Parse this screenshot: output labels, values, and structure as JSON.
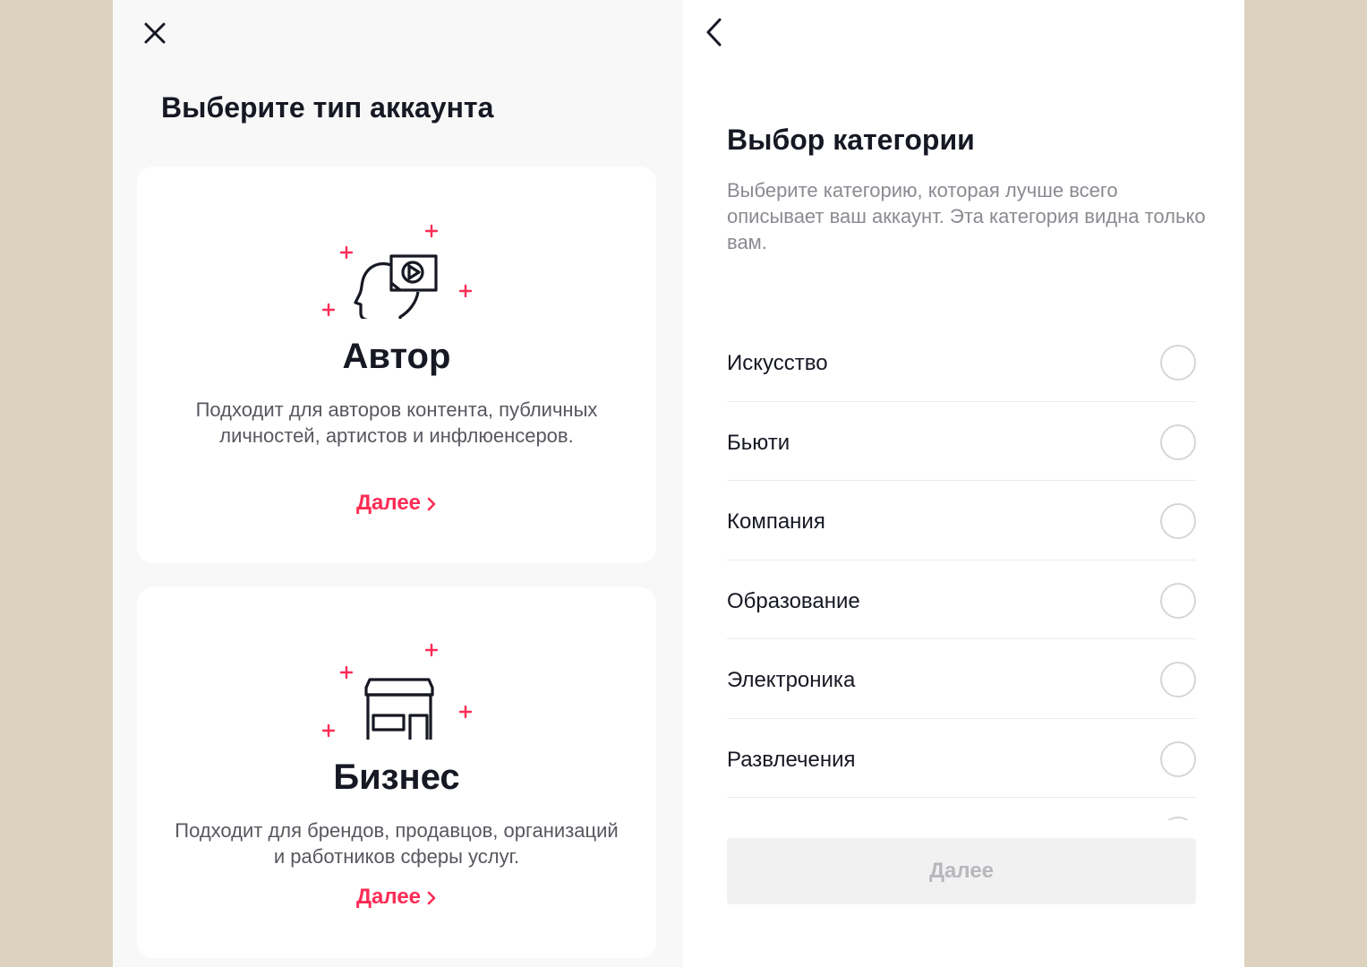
{
  "colors": {
    "background": "#dcd2bd",
    "accent": "#fe2c55",
    "text": "#161823",
    "muted": "#8a8b91",
    "disabled_button": "#f1f1f2"
  },
  "account_type": {
    "title": "Выберите тип аккаунта",
    "close_icon": "close-icon",
    "cards": [
      {
        "icon": "creator-head-play-icon",
        "title": "Автор",
        "description": "Подходит для авторов контента, публичных личностей, артистов и инфлюенсеров.",
        "link": "Далее"
      },
      {
        "icon": "storefront-icon",
        "title": "Бизнес",
        "description": "Подходит для брендов, продавцов, организаций и работников сферы услуг.",
        "link": "Далее"
      }
    ]
  },
  "category": {
    "back_icon": "chevron-left-icon",
    "title": "Выбор категории",
    "description": "Выберите категорию, которая лучше всего описывает ваш аккаунт. Эта категория видна только вам.",
    "items": [
      {
        "label": "Искусство",
        "selected": false
      },
      {
        "label": "Бьюти",
        "selected": false
      },
      {
        "label": "Компания",
        "selected": false
      },
      {
        "label": "Образование",
        "selected": false
      },
      {
        "label": "Электроника",
        "selected": false
      },
      {
        "label": "Развлечения",
        "selected": false
      }
    ],
    "next_button": "Далее",
    "next_enabled": false
  }
}
